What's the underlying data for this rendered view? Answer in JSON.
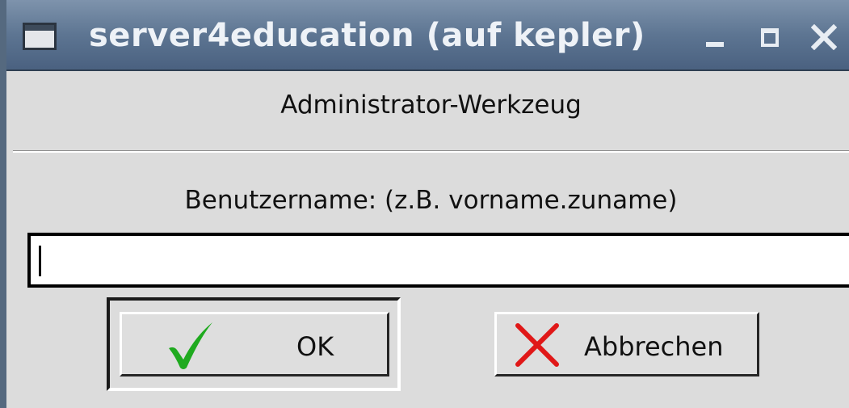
{
  "window": {
    "title": "server4education (auf kepler)",
    "controls": {
      "minimize_icon": "minimize-icon",
      "maximize_icon": "maximize-icon",
      "close_icon": "close-icon"
    }
  },
  "dialog": {
    "heading": "Administrator-Werkzeug",
    "username_label": "Benutzername: (z.B. vorname.zuname)",
    "username_value": ""
  },
  "buttons": {
    "ok": {
      "label": "OK",
      "icon": "checkmark-icon",
      "color": "#1faa1f"
    },
    "cancel": {
      "label": "Abbrechen",
      "icon": "cross-icon",
      "color": "#e01818"
    }
  },
  "colors": {
    "titlebar": "#5d7592",
    "dialog_background": "#dcdcdc"
  }
}
